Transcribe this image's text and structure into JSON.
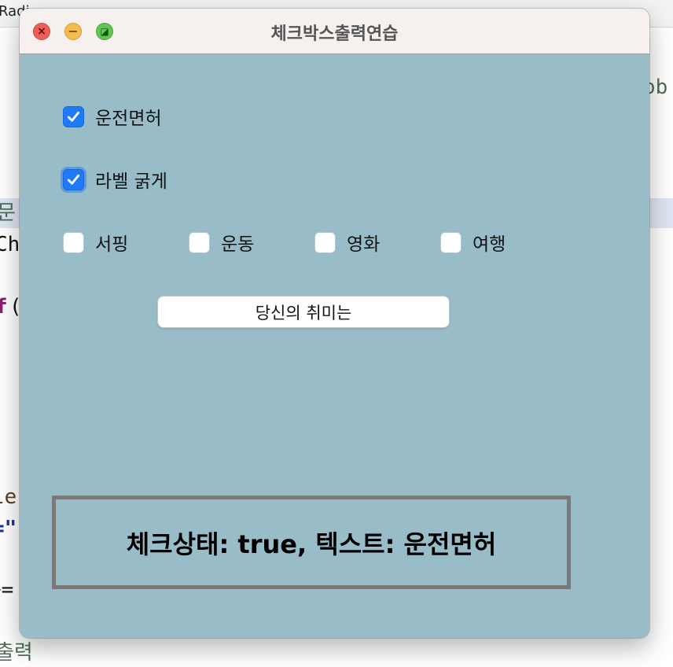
{
  "background_ide": {
    "tab_label": "Radi",
    "fragments": [
      {
        "id": "frag-ob",
        "text": "ob",
        "color": "#4f6f58"
      },
      {
        "id": "frag-mun",
        "text": "문",
        "color": "#4f6f58"
      },
      {
        "id": "frag-ch",
        "text": "Ch",
        "color": "#111111"
      },
      {
        "id": "frag-if",
        "text": "f",
        "color": "#8a1d70"
      },
      {
        "id": "frag-paren",
        "text": "(",
        "color": "#111111"
      },
      {
        "id": "frag-le",
        "text": "le",
        "color": "#5a3e2b"
      },
      {
        "id": "frag-quote",
        "text": "=\"",
        "color": "#1d2fa8"
      },
      {
        "id": "frag-pluseq",
        "text": "+=",
        "color": "#111111"
      },
      {
        "id": "frag-chul",
        "text": "출력",
        "color": "#4f6f58"
      }
    ]
  },
  "window": {
    "title": "체크박스출력연습",
    "controls": {
      "close_glyph": "×",
      "minimize_glyph": "−",
      "maximize_glyph": "◪"
    }
  },
  "checkboxes": {
    "license": {
      "label": "운전면허",
      "checked": true
    },
    "bold_label": {
      "label": "라벨 굵게",
      "checked": true,
      "focused": true
    },
    "hobbies": [
      {
        "label": "서핑",
        "checked": false
      },
      {
        "label": "운동",
        "checked": false
      },
      {
        "label": "영화",
        "checked": false
      },
      {
        "label": "여행",
        "checked": false
      }
    ]
  },
  "button": {
    "label": "당신의 취미는"
  },
  "result": {
    "text": "체크상태: true, 텍스트: 운전면허"
  },
  "colors": {
    "window_bg": "#98bdc9",
    "checkbox_checked": "#1f7bf5",
    "result_border": "#7a7a7a"
  }
}
